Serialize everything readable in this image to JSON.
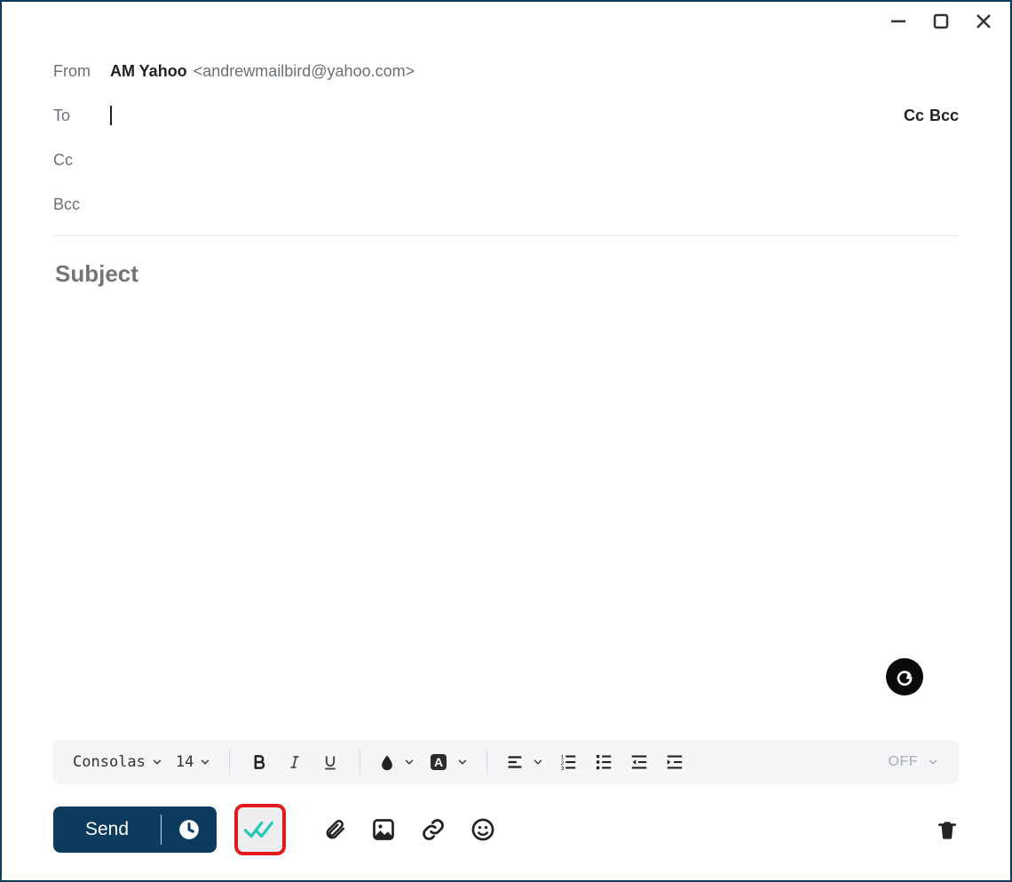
{
  "window": {
    "minimize": "–",
    "maximize": "□",
    "close": "×"
  },
  "compose": {
    "from_label": "From",
    "from_name": "AM Yahoo",
    "from_email": "<andrewmailbird@yahoo.com>",
    "to_label": "To",
    "to_value": "",
    "cc_link": "Cc",
    "bcc_link": "Bcc",
    "cc_label": "Cc",
    "bcc_label": "Bcc",
    "subject_placeholder": "Subject",
    "subject_value": ""
  },
  "format": {
    "font_family": "Consolas",
    "font_size": "14",
    "off_label": "OFF"
  },
  "actions": {
    "send_label": "Send"
  }
}
